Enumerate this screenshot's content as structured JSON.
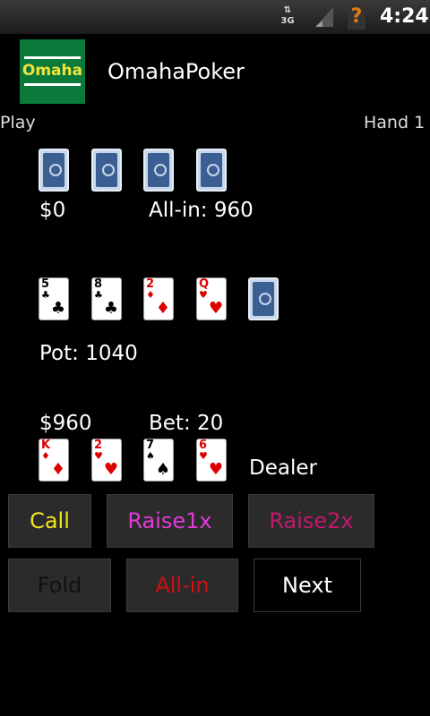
{
  "status_bar": {
    "network": "3G",
    "time": "4:24",
    "signal_icon": "signal-icon",
    "notification_icon": "alert-icon"
  },
  "app": {
    "title": "OmahaPoker",
    "logo_text": "Omaha"
  },
  "labels": {
    "play": "Play",
    "hand": "Hand 1"
  },
  "opponent": {
    "money": "$0",
    "status": "All-in: 960",
    "cards": [
      "back",
      "back",
      "back",
      "back"
    ]
  },
  "board": {
    "cards": [
      {
        "rank": "5",
        "suit": "♣",
        "color": "#000"
      },
      {
        "rank": "8",
        "suit": "♣",
        "color": "#000"
      },
      {
        "rank": "2",
        "suit": "♦",
        "color": "#d00"
      },
      {
        "rank": "Q",
        "suit": "♥",
        "color": "#d00"
      },
      {
        "rank": "",
        "suit": "",
        "color": "",
        "back": true
      }
    ],
    "pot": "Pot: 1040"
  },
  "player": {
    "money": "$960",
    "bet": "Bet: 20",
    "dealer": "Dealer",
    "cards": [
      {
        "rank": "K",
        "suit": "♦",
        "color": "#d00"
      },
      {
        "rank": "2",
        "suit": "♥",
        "color": "#d00"
      },
      {
        "rank": "7",
        "suit": "♠",
        "color": "#000"
      },
      {
        "rank": "6",
        "suit": "♥",
        "color": "#d00"
      }
    ]
  },
  "buttons": {
    "call": {
      "label": "Call",
      "color": "#f2e51c"
    },
    "raise1x": {
      "label": "Raise1x",
      "color": "#e03ad8"
    },
    "raise2x": {
      "label": "Raise2x",
      "color": "#c0186e"
    },
    "fold": {
      "label": "Fold",
      "color": "#111111"
    },
    "allin": {
      "label": "All-in",
      "color": "#d01010"
    },
    "next": {
      "label": "Next",
      "color": "#ffffff"
    }
  }
}
